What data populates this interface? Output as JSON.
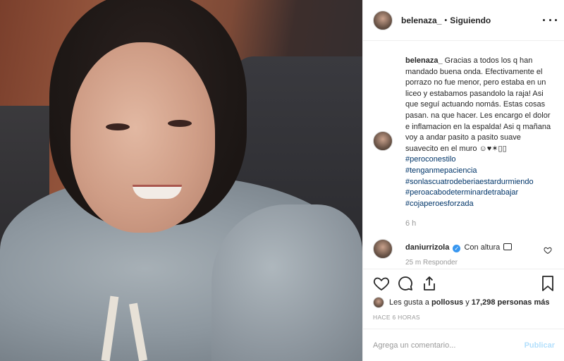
{
  "post": {
    "author": "belenaza_",
    "separator": "•",
    "follow_status": "Siguiendo"
  },
  "caption": {
    "username": "belenaza_",
    "text": "Gracias a todos los q han mandado buena onda. Efectivamente el porrazo no fue menor, pero estaba en un liceo y estabamos pasandolo la raja! Asi que seguí actuando nomás. Estas cosas pasan. na que hacer. Les encargo el dolor e inflamacion en la espalda! Asi q mañana voy a andar pasito a pasito suave suavecito en el muro ☺♥✶▯▯",
    "hashtags": [
      "#peroconestilo",
      "#tenganmepaciencia",
      "#sonlascuatrodeberiaestardurmiendo",
      "#peroacabodeterminardetrabajar",
      "#cojaperoesforzada"
    ],
    "time": "6 h"
  },
  "comment": {
    "username": "daniurrizola",
    "verified_mark": "✓",
    "text": "Con altura",
    "meta": "25 m   Responder"
  },
  "actions": {
    "icons": [
      "heart-icon",
      "comment-icon",
      "share-icon",
      "bookmark-icon"
    ]
  },
  "likes": {
    "prefix": "Les gusta a",
    "user": "pollosus",
    "connector": "y",
    "count": "17,298 personas más"
  },
  "time_ago": "HACE 6 HORAS",
  "add_comment": {
    "placeholder": "Agrega un comentario...",
    "publish_label": "Publicar"
  },
  "colors": {
    "link": "#003569",
    "publish_disabled": "#b2dffc",
    "verified": "#3897f0",
    "muted": "#999999"
  }
}
